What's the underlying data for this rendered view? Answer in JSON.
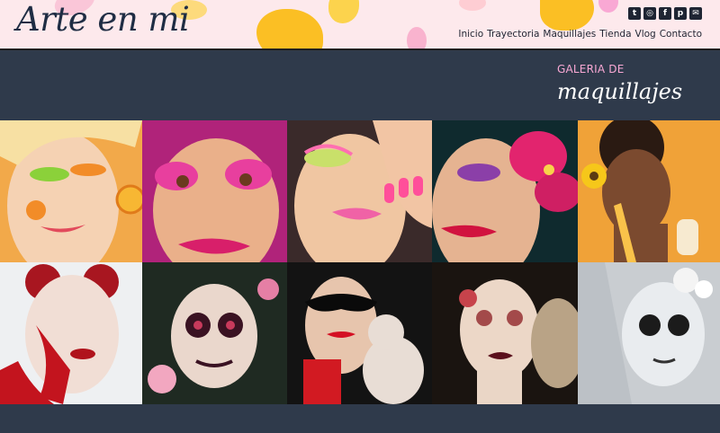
{
  "site": {
    "logo": "Arte en mi"
  },
  "social": [
    {
      "icon": "twitter-icon",
      "glyph": "t"
    },
    {
      "icon": "instagram-icon",
      "glyph": "◎"
    },
    {
      "icon": "facebook-icon",
      "glyph": "f"
    },
    {
      "icon": "pinterest-icon",
      "glyph": "p"
    },
    {
      "icon": "email-icon",
      "glyph": "✉"
    }
  ],
  "nav": [
    "Inicio",
    "Trayectoria",
    "Maquillajes",
    "Tienda",
    "Vlog",
    "Contacto"
  ],
  "gallery": {
    "subtitle": "GALERIA DE",
    "title": "maquillajes",
    "images": [
      "makeup-photo-citrus",
      "makeup-photo-pink-lashes",
      "makeup-photo-pink-nails",
      "makeup-photo-purple-flower",
      "makeup-photo-sunflower",
      "makeup-photo-red-hands",
      "makeup-photo-catrina",
      "makeup-photo-lace-mask",
      "makeup-photo-dark-lips",
      "makeup-photo-white-veil"
    ]
  },
  "colors": {
    "header_bg": "#fde9ec",
    "banner_bg": "#2f3a4b",
    "accent_pink": "#f9a8d4",
    "accent_yellow": "#fbbf24",
    "text_dark": "#1f2533"
  }
}
